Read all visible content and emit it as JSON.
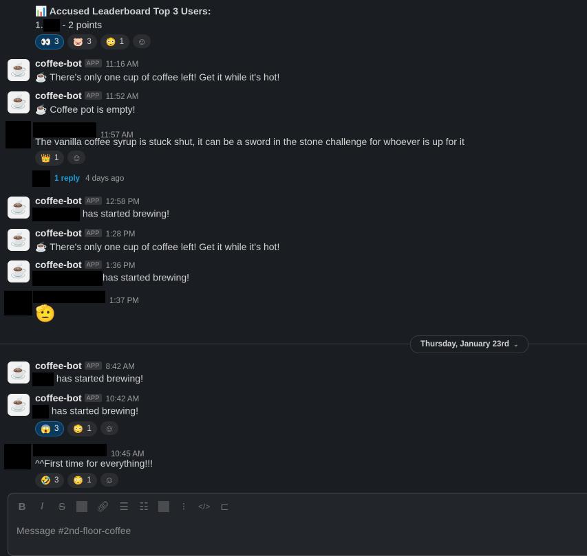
{
  "leaderboard": {
    "title": "📊 Accused Leaderboard Top 3 Users:",
    "entry_prefix": "1.",
    "entry_suffix": "- 2 points",
    "reactions": [
      {
        "emoji": "👀",
        "count": "3",
        "active": true
      },
      {
        "emoji": "🐷",
        "count": "3"
      },
      {
        "emoji": "😳",
        "count": "1"
      }
    ]
  },
  "messages": [
    {
      "name": "coffee-bot",
      "badge": "APP",
      "time": "11:16 AM",
      "text": "☕ There's only one cup of coffee left! Get it while it's hot!"
    },
    {
      "name": "coffee-bot",
      "badge": "APP",
      "time": "11:52 AM",
      "text": "☕ Coffee pot is empty!"
    },
    {
      "time": "11:57 AM",
      "text": "The vanilla coffee syrup is stuck shut, it can be a sword in the stone challenge for whoever is up for it",
      "reactions": [
        {
          "emoji": "👑",
          "count": "1"
        }
      ],
      "thread": {
        "replies": "1 reply",
        "last": "4 days ago"
      }
    },
    {
      "name": "coffee-bot",
      "badge": "APP",
      "time": "12:58 PM",
      "text": "has started brewing!"
    },
    {
      "name": "coffee-bot",
      "badge": "APP",
      "time": "1:28 PM",
      "text": "☕ There's only one cup of coffee left! Get it while it's hot!"
    },
    {
      "name": "coffee-bot",
      "badge": "APP",
      "time": "1:36 PM",
      "text": "has started brewing!"
    },
    {
      "time": "1:37 PM",
      "emoji": "🫡"
    }
  ],
  "date_divider": "Thursday, January 23rd",
  "messages2": [
    {
      "name": "coffee-bot",
      "badge": "APP",
      "time": "8:42 AM",
      "text": "has started brewing!"
    },
    {
      "name": "coffee-bot",
      "badge": "APP",
      "time": "10:42 AM",
      "text": "has started brewing!",
      "reactions": [
        {
          "emoji": "😱",
          "count": "3",
          "active": true
        },
        {
          "emoji": "😳",
          "count": "1"
        }
      ]
    },
    {
      "time": "10:45 AM",
      "text": "^^First time for everything!!!",
      "reactions": [
        {
          "emoji": "🤣",
          "count": "3"
        },
        {
          "emoji": "😳",
          "count": "1"
        }
      ]
    }
  ],
  "composer": {
    "placeholder": "Message #2nd-floor-coffee"
  },
  "icons": {
    "add_reaction": "smiley-plus-icon",
    "chevron": "chevron-down-icon",
    "avatar": "coffee-cup-icon"
  }
}
